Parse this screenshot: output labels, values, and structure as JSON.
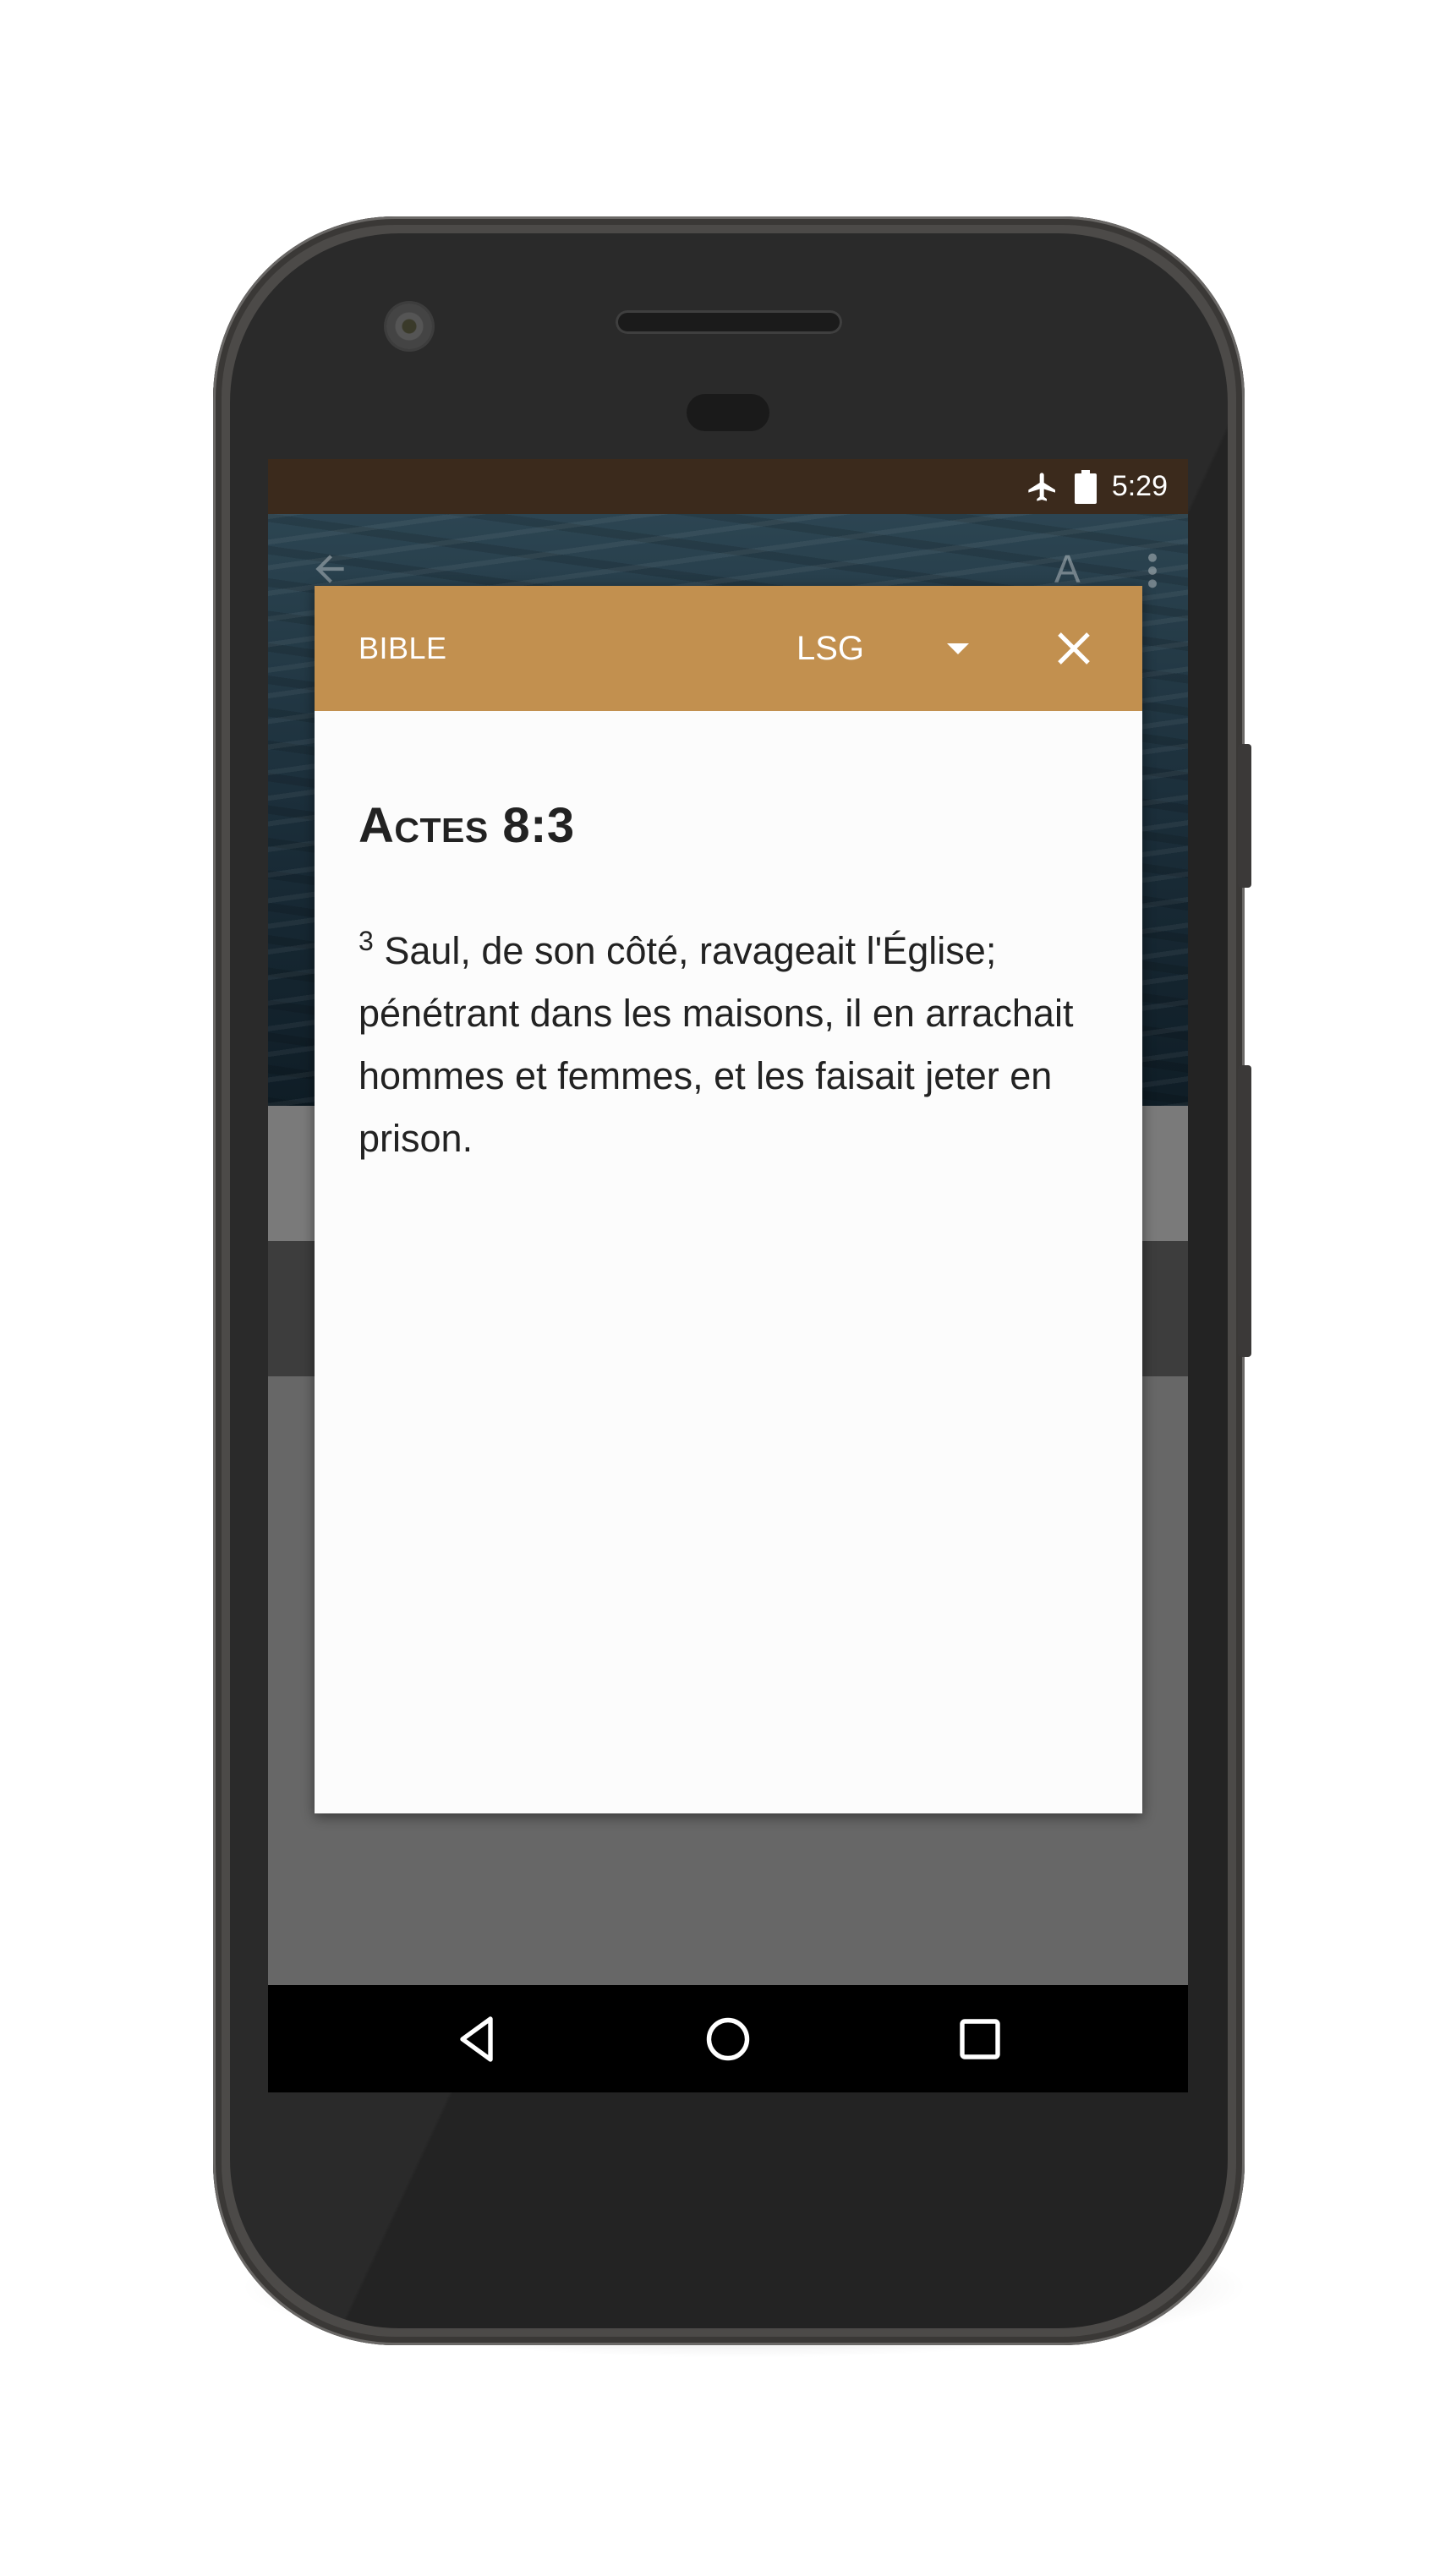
{
  "status_bar": {
    "time": "5:29",
    "icons": [
      "airplane-mode-icon",
      "battery-icon"
    ]
  },
  "app_bar_background": {
    "icons": [
      "back-arrow-icon",
      "text-size-icon",
      "more-vert-icon"
    ],
    "text_size_label": "A"
  },
  "dialog": {
    "header": {
      "title": "BIBLE",
      "version": "LSG",
      "version_dropdown_icon": "caret-down-icon",
      "close_icon": "close-icon",
      "background_color": "#c2904f"
    },
    "reference": "Actes 8:3",
    "verse_number": "3",
    "verse_text": "Saul, de son côté, ravageait l'Église; pénétrant dans les maisons, il en arrachait hommes et femmes, et les faisait jeter en prison."
  },
  "nav_bar": {
    "buttons": [
      "back-triangle-icon",
      "home-circle-icon",
      "recents-square-icon"
    ]
  }
}
